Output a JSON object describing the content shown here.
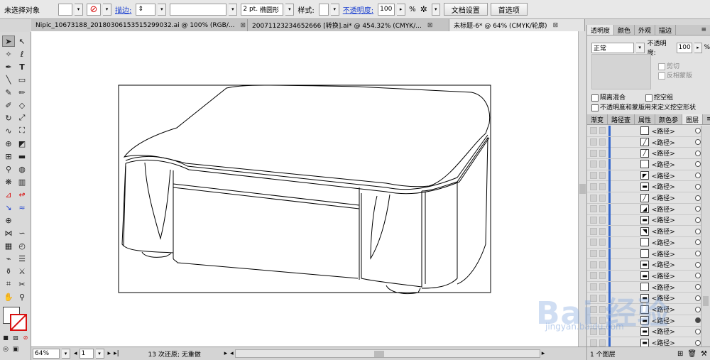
{
  "control_bar": {
    "selection_label": "未选择对象",
    "stroke_label": "描边:",
    "stroke_weight": "2 pt.",
    "brush_name": "椭圆形",
    "style_label": "样式:",
    "opacity_label": "不透明度:",
    "opacity_value": "100",
    "percent": "%",
    "doc_setup_button": "文档设置",
    "preferences_button": "首选项"
  },
  "doc_tabs": [
    {
      "label": "Nipic_10673188_20180306153515299032.ai @ 100% (RGB/...",
      "close": "⊠"
    },
    {
      "label": "20071123234652666 [转换].ai* @ 454.32% (CMYK/...",
      "close": "⊠"
    },
    {
      "label": "未标题-6* @ 64% (CMYK/轮廓)",
      "close": "⊠"
    }
  ],
  "status_bar": {
    "zoom": "64%",
    "artboard": "1",
    "history": "13 次还原; 无重做"
  },
  "transparency_panel": {
    "tabs": [
      "透明度",
      "颜色",
      "外观",
      "描边"
    ],
    "blend_mode": "正常",
    "opacity_label": "不透明度:",
    "opacity_value": "100",
    "percent": "%",
    "clip_label": "剪切",
    "invert_label": "反相蒙版",
    "isolate_label": "隔离混合",
    "knockout_label": "挖空组",
    "opacity_mask_label": "不透明度和蒙版用来定义挖空形状"
  },
  "layers_panel": {
    "tabs": [
      "渐变",
      "路径查",
      "属性",
      "颜色参",
      "图层"
    ],
    "row_label": "<路径>",
    "row_count": 20,
    "footer": "1 个图层"
  },
  "watermark": {
    "text": "Bai 经验",
    "url": "jingyan.baidu.com"
  },
  "colors": {
    "link_blue": "#1a3fd0",
    "layer_blue": "#3366cc",
    "stroke_red": "#d81010"
  }
}
